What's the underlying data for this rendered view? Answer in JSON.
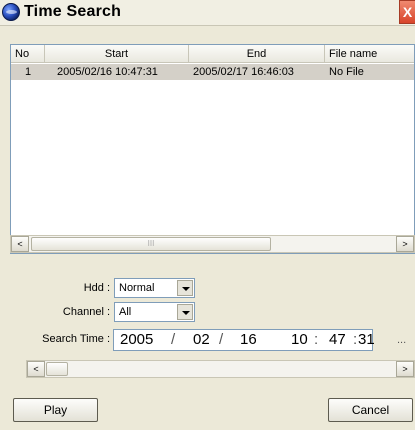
{
  "window": {
    "title": "Time Search",
    "close_glyph": "X"
  },
  "list": {
    "columns": [
      "No",
      "Start",
      "End",
      "File name"
    ],
    "rows": [
      {
        "no": "1",
        "start": "2005/02/16  10:47:31",
        "end": "2005/02/17  16:46:03",
        "file": "No File"
      }
    ]
  },
  "form": {
    "hdd_label": "Hdd :",
    "hdd_value": "Normal",
    "channel_label": "Channel :",
    "channel_value": "All",
    "search_time_label": "Search Time :",
    "search_time": {
      "year": "2005",
      "month": "02",
      "day": "16",
      "hour": "10",
      "minute": "47",
      "second": "31",
      "date_sep": "/",
      "time_sep": ":"
    },
    "ellipsis": "..."
  },
  "scroll": {
    "left_glyph": "<",
    "right_glyph": ">",
    "thumb_grip": "III"
  },
  "buttons": {
    "play": "Play",
    "cancel": "Cancel"
  }
}
